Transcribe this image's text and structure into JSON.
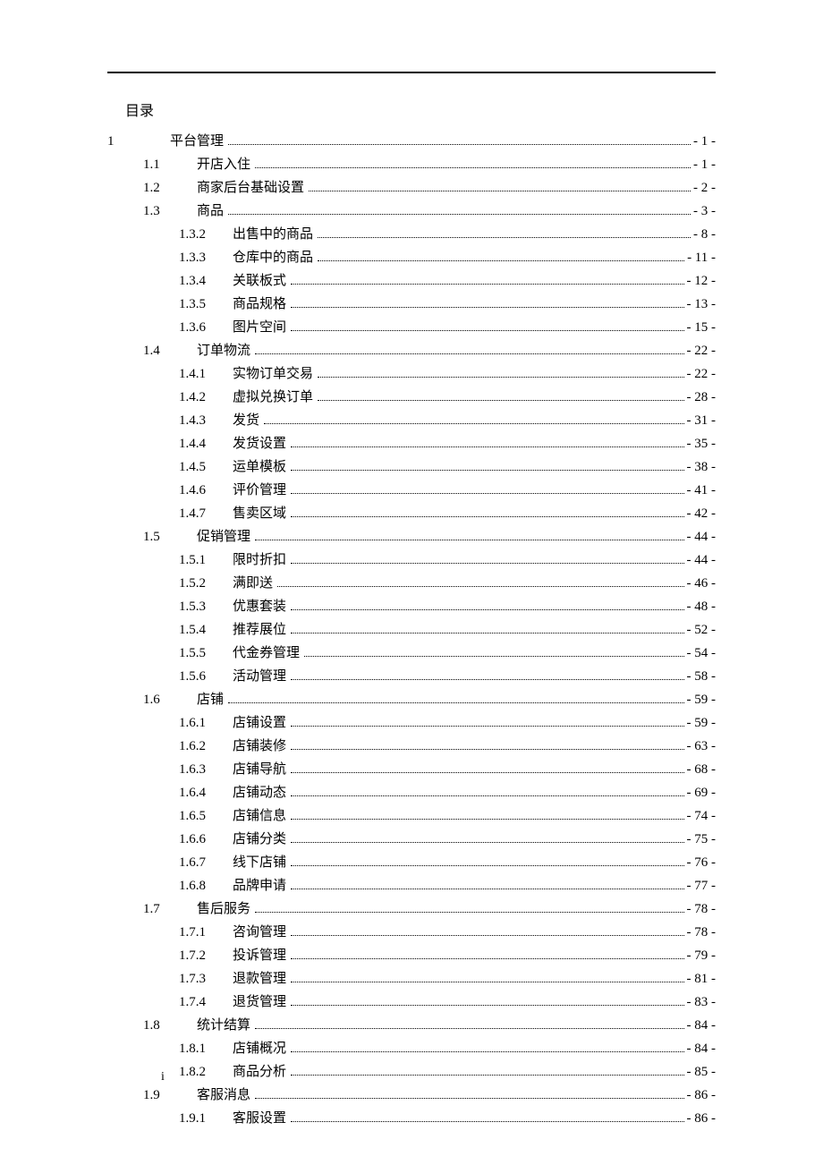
{
  "toc_title": "目录",
  "page_footer": "i",
  "entries": [
    {
      "level": 1,
      "num": "1",
      "label": "平台管理",
      "page": "- 1 -"
    },
    {
      "level": 2,
      "num": "1.1",
      "label": "开店入住",
      "page": "- 1 -"
    },
    {
      "level": 2,
      "num": "1.2",
      "label": "商家后台基础设置",
      "page": "- 2 -"
    },
    {
      "level": 2,
      "num": "1.3",
      "label": "商品",
      "page": "- 3 -"
    },
    {
      "level": 3,
      "num": "1.3.2",
      "label": "出售中的商品",
      "page": "- 8 -"
    },
    {
      "level": 3,
      "num": "1.3.3",
      "label": "仓库中的商品",
      "page": "- 11 -"
    },
    {
      "level": 3,
      "num": "1.3.4",
      "label": "关联板式",
      "page": "- 12 -"
    },
    {
      "level": 3,
      "num": "1.3.5",
      "label": "商品规格",
      "page": "- 13 -"
    },
    {
      "level": 3,
      "num": "1.3.6",
      "label": "图片空间",
      "page": "- 15 -"
    },
    {
      "level": 2,
      "num": "1.4",
      "label": "订单物流",
      "page": "- 22 -"
    },
    {
      "level": 3,
      "num": "1.4.1",
      "label": "实物订单交易",
      "page": "- 22 -"
    },
    {
      "level": 3,
      "num": "1.4.2",
      "label": "虚拟兑换订单",
      "page": "- 28 -"
    },
    {
      "level": 3,
      "num": "1.4.3",
      "label": "发货",
      "page": "- 31 -"
    },
    {
      "level": 3,
      "num": "1.4.4",
      "label": "发货设置",
      "page": "- 35 -"
    },
    {
      "level": 3,
      "num": "1.4.5",
      "label": "运单模板",
      "page": "- 38 -"
    },
    {
      "level": 3,
      "num": "1.4.6",
      "label": "评价管理",
      "page": "- 41 -"
    },
    {
      "level": 3,
      "num": "1.4.7",
      "label": "售卖区域",
      "page": "- 42 -"
    },
    {
      "level": 2,
      "num": "1.5",
      "label": "促销管理",
      "page": "- 44 -"
    },
    {
      "level": 3,
      "num": "1.5.1",
      "label": "限时折扣",
      "page": "- 44 -"
    },
    {
      "level": 3,
      "num": "1.5.2",
      "label": "满即送",
      "page": "- 46 -"
    },
    {
      "level": 3,
      "num": "1.5.3",
      "label": "优惠套装",
      "page": "- 48 -"
    },
    {
      "level": 3,
      "num": "1.5.4",
      "label": "推荐展位",
      "page": "- 52 -"
    },
    {
      "level": 3,
      "num": "1.5.5",
      "label": "代金券管理",
      "page": "- 54 -"
    },
    {
      "level": 3,
      "num": "1.5.6",
      "label": "活动管理",
      "page": "- 58 -"
    },
    {
      "level": 2,
      "num": "1.6",
      "label": "店铺",
      "page": "- 59 -"
    },
    {
      "level": 3,
      "num": "1.6.1",
      "label": "店铺设置",
      "page": "- 59 -"
    },
    {
      "level": 3,
      "num": "1.6.2",
      "label": "店铺装修",
      "page": "- 63 -"
    },
    {
      "level": 3,
      "num": "1.6.3",
      "label": "店铺导航",
      "page": "- 68 -"
    },
    {
      "level": 3,
      "num": "1.6.4",
      "label": "店铺动态",
      "page": "- 69 -"
    },
    {
      "level": 3,
      "num": "1.6.5",
      "label": "店铺信息",
      "page": "- 74 -"
    },
    {
      "level": 3,
      "num": "1.6.6",
      "label": "店铺分类",
      "page": "- 75 -"
    },
    {
      "level": 3,
      "num": "1.6.7",
      "label": "线下店铺",
      "page": "- 76 -"
    },
    {
      "level": 3,
      "num": "1.6.8",
      "label": "品牌申请",
      "page": "- 77 -"
    },
    {
      "level": 2,
      "num": "1.7",
      "label": "售后服务",
      "page": "- 78 -"
    },
    {
      "level": 3,
      "num": "1.7.1",
      "label": "咨询管理",
      "page": "- 78 -"
    },
    {
      "level": 3,
      "num": "1.7.2",
      "label": "投诉管理",
      "page": "- 79 -"
    },
    {
      "level": 3,
      "num": "1.7.3",
      "label": "退款管理",
      "page": "- 81 -"
    },
    {
      "level": 3,
      "num": "1.7.4",
      "label": "退货管理",
      "page": "- 83 -"
    },
    {
      "level": 2,
      "num": "1.8",
      "label": "统计结算",
      "page": "- 84 -"
    },
    {
      "level": 3,
      "num": "1.8.1",
      "label": "店铺概况",
      "page": "- 84 -"
    },
    {
      "level": 3,
      "num": "1.8.2",
      "label": "商品分析",
      "page": "- 85 -"
    },
    {
      "level": 2,
      "num": "1.9",
      "label": "客服消息",
      "page": "- 86 -"
    },
    {
      "level": 3,
      "num": "1.9.1",
      "label": "客服设置",
      "page": "- 86 -"
    }
  ]
}
